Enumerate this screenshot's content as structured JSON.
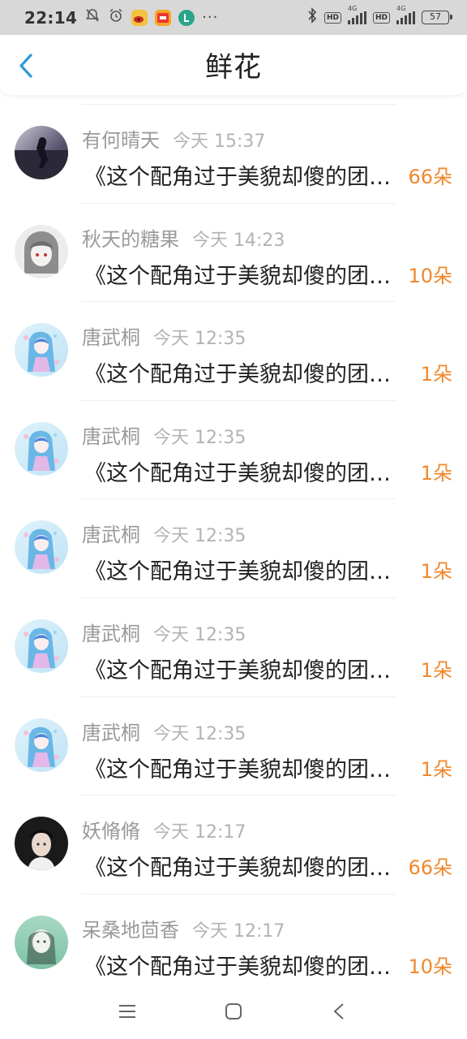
{
  "status_bar": {
    "time": "22:14",
    "more": "···",
    "hd1": "HD",
    "hd2": "HD",
    "net1": "4G",
    "net2": "4G",
    "battery": "57"
  },
  "header": {
    "title": "鲜花",
    "back_icon": "chevron-left-icon"
  },
  "messages": [
    {
      "user": "有何晴天",
      "time": "今天 15:37",
      "text": "《这个配角过于美貌却傻的团宠》",
      "flowers": "66朵",
      "avatar": "dark-photo"
    },
    {
      "user": "秋天的糖果",
      "time": "今天 14:23",
      "text": "《这个配角过于美貌却傻的团宠》",
      "flowers": "10朵",
      "avatar": "anime-grey"
    },
    {
      "user": "唐武桐",
      "time": "今天 12:35",
      "text": "《这个配角过于美貌却傻的团宠》",
      "flowers": "1朵",
      "avatar": "anime-blue"
    },
    {
      "user": "唐武桐",
      "time": "今天 12:35",
      "text": "《这个配角过于美貌却傻的团宠》",
      "flowers": "1朵",
      "avatar": "anime-blue"
    },
    {
      "user": "唐武桐",
      "time": "今天 12:35",
      "text": "《这个配角过于美貌却傻的团宠》",
      "flowers": "1朵",
      "avatar": "anime-blue"
    },
    {
      "user": "唐武桐",
      "time": "今天 12:35",
      "text": "《这个配角过于美貌却傻的团宠》",
      "flowers": "1朵",
      "avatar": "anime-blue"
    },
    {
      "user": "唐武桐",
      "time": "今天 12:35",
      "text": "《这个配角过于美貌却傻的团宠》",
      "flowers": "1朵",
      "avatar": "anime-blue"
    },
    {
      "user": "妖脩脩",
      "time": "今天 12:17",
      "text": "《这个配角过于美貌却傻的团宠》",
      "flowers": "66朵",
      "avatar": "portrait-dark"
    },
    {
      "user": "呆桑地茴香",
      "time": "今天 12:17",
      "text": "《这个配角过于美貌却傻的团宠》",
      "flowers": "10朵",
      "avatar": "portrait-green"
    }
  ],
  "nav": {
    "menu_icon": "menu-icon",
    "home_icon": "home-square-icon",
    "back_icon": "back-triangle-icon"
  },
  "colors": {
    "accent": "#2e9bd6",
    "flower_count": "#f0882c",
    "name": "#9a9a9a",
    "time": "#b3b3b3"
  }
}
